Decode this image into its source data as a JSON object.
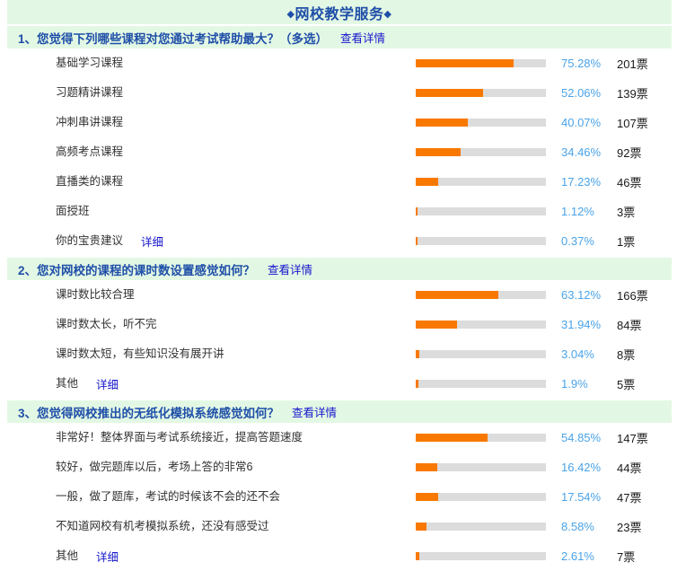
{
  "header": {
    "title": "网校教学服务",
    "decoration_left": "◆",
    "decoration_right": "◆",
    "accent_color": "#1f4fa8",
    "band_color": "#e3f8e4"
  },
  "style": {
    "bar_fill_color": "#f97900",
    "bar_track_color": "#dcdcdc",
    "percent_color": "#4aa3e8",
    "link_color": "#1515cc"
  },
  "questions": [
    {
      "number": "1、",
      "title": "您觉得下列哪些课程对您通过考试帮助最大？（多选）",
      "detail_label": "查看详情",
      "options": [
        {
          "label": "基础学习课程",
          "sub_link": "",
          "percent": "75.28%",
          "percent_value": 75.28,
          "votes": "201票"
        },
        {
          "label": "习题精讲课程",
          "sub_link": "",
          "percent": "52.06%",
          "percent_value": 52.06,
          "votes": "139票"
        },
        {
          "label": "冲刺串讲课程",
          "sub_link": "",
          "percent": "40.07%",
          "percent_value": 40.07,
          "votes": "107票"
        },
        {
          "label": "高频考点课程",
          "sub_link": "",
          "percent": "34.46%",
          "percent_value": 34.46,
          "votes": "92票"
        },
        {
          "label": "直播类的课程",
          "sub_link": "",
          "percent": "17.23%",
          "percent_value": 17.23,
          "votes": "46票"
        },
        {
          "label": "面授班",
          "sub_link": "",
          "percent": "1.12%",
          "percent_value": 1.12,
          "votes": "3票"
        },
        {
          "label": "你的宝贵建议",
          "sub_link": "详细",
          "percent": "0.37%",
          "percent_value": 0.37,
          "votes": "1票"
        }
      ]
    },
    {
      "number": "2、",
      "title": "您对网校的课程的课时数设置感觉如何？",
      "detail_label": "查看详情",
      "options": [
        {
          "label": "课时数比较合理",
          "sub_link": "",
          "percent": "63.12%",
          "percent_value": 63.12,
          "votes": "166票"
        },
        {
          "label": "课时数太长，听不完",
          "sub_link": "",
          "percent": "31.94%",
          "percent_value": 31.94,
          "votes": "84票"
        },
        {
          "label": "课时数太短，有些知识没有展开讲",
          "sub_link": "",
          "percent": "3.04%",
          "percent_value": 3.04,
          "votes": "8票"
        },
        {
          "label": "其他",
          "sub_link": "详细",
          "percent": "1.9%",
          "percent_value": 1.9,
          "votes": "5票"
        }
      ]
    },
    {
      "number": "3、",
      "title": "您觉得网校推出的无纸化模拟系统感觉如何？",
      "detail_label": "查看详情",
      "options": [
        {
          "label": "非常好！整体界面与考试系统接近，提高答题速度",
          "sub_link": "",
          "percent": "54.85%",
          "percent_value": 54.85,
          "votes": "147票"
        },
        {
          "label": "较好，做完题库以后，考场上答的非常6",
          "sub_link": "",
          "percent": "16.42%",
          "percent_value": 16.42,
          "votes": "44票"
        },
        {
          "label": "一般，做了题库，考试的时候该不会的还不会",
          "sub_link": "",
          "percent": "17.54%",
          "percent_value": 17.54,
          "votes": "47票"
        },
        {
          "label": "不知道网校有机考模拟系统，还没有感受过",
          "sub_link": "",
          "percent": "8.58%",
          "percent_value": 8.58,
          "votes": "23票"
        },
        {
          "label": "其他",
          "sub_link": "详细",
          "percent": "2.61%",
          "percent_value": 2.61,
          "votes": "7票"
        }
      ]
    }
  ]
}
